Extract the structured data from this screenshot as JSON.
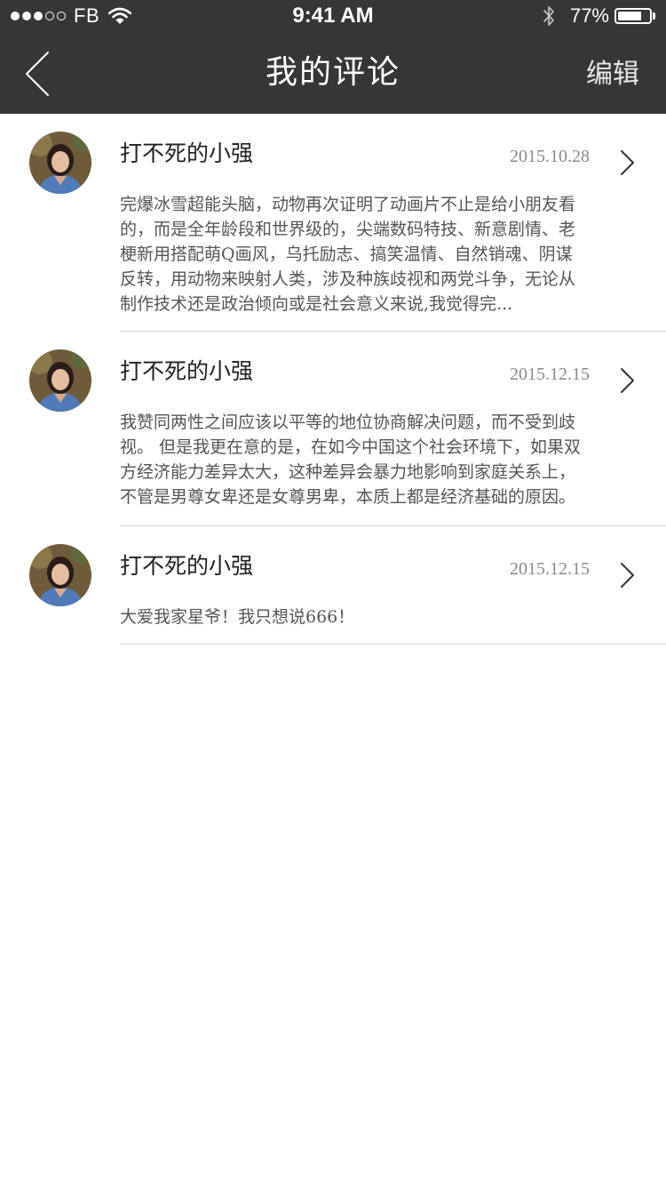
{
  "status_bar": {
    "signal_filled": 3,
    "signal_total": 5,
    "carrier": "FB",
    "time": "9:41 AM",
    "battery_percent": "77%",
    "battery_level": 0.77
  },
  "nav": {
    "back_icon": "chevron-left-icon",
    "title": "我的评论",
    "edit_label": "编辑"
  },
  "comments": [
    {
      "username": "打不死的小强",
      "date": "2015.10.28",
      "text": "完爆冰雪超能头脑，动物再次证明了动画片不止是给小朋友看的，而是全年龄段和世界级的，尖端数码特技、新意剧情、老梗新用搭配萌Q画风，乌托励志、搞笑温情、自然销魂、阴谋反转，用动物来映射人类，涉及种族歧视和两党斗争，无论从制作技术还是政治倾向或是社会意义来说,我觉得完..."
    },
    {
      "username": "打不死的小强",
      "date": "2015.12.15",
      "text": "我赞同两性之间应该以平等的地位协商解决问题，而不受到歧视。 但是我更在意的是，在如今中国这个社会环境下，如果双方经济能力差异太大，这种差异会暴力地影响到家庭关系上，不管是男尊女卑还是女尊男卑，本质上都是经济基础的原因。"
    },
    {
      "username": "打不死的小强",
      "date": "2015.12.15",
      "text": "大爱我家星爷！我只想说666！"
    }
  ],
  "colors": {
    "bar_background": "#363636",
    "divider": "#d4d4d4",
    "date_text": "#8a8a8a",
    "body_text": "#555555"
  }
}
